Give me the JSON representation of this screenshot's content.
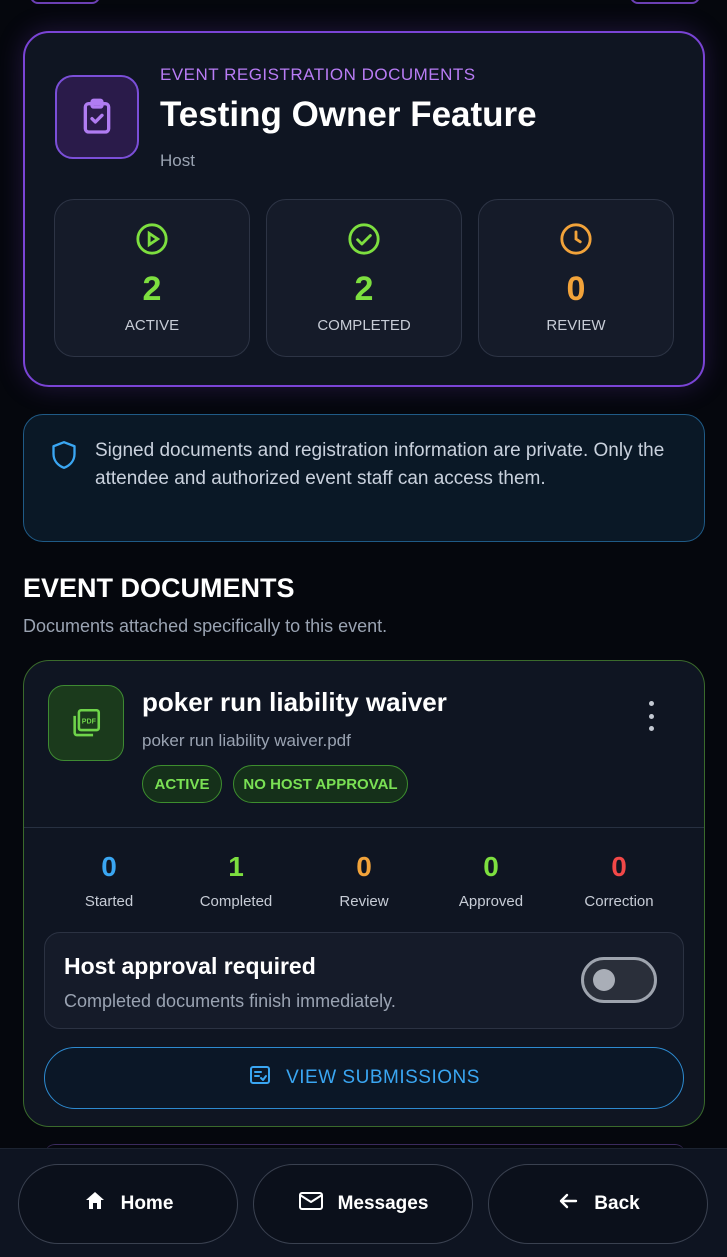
{
  "header": {
    "eyebrow": "EVENT REGISTRATION DOCUMENTS",
    "title": "Testing Owner Feature",
    "role": "Host",
    "icon": "clipboard-check-icon",
    "stats": [
      {
        "value": "2",
        "label": "ACTIVE",
        "color": "#7ddf3f",
        "icon": "play-circle-icon"
      },
      {
        "value": "2",
        "label": "COMPLETED",
        "color": "#7ddf3f",
        "icon": "check-circle-icon"
      },
      {
        "value": "0",
        "label": "REVIEW",
        "color": "#f2a33a",
        "icon": "clock-icon"
      }
    ]
  },
  "privacy": {
    "text": "Signed documents and registration information are private. Only the attendee and authorized event staff can access them."
  },
  "section": {
    "title": "EVENT DOCUMENTS",
    "subtitle": "Documents attached specifically to this event."
  },
  "document": {
    "name": "poker run liability waiver",
    "file": "poker run liability waiver.pdf",
    "badges": [
      "ACTIVE",
      "NO HOST APPROVAL"
    ],
    "metrics": [
      {
        "value": "0",
        "label": "Started",
        "color": "#3aa6f2"
      },
      {
        "value": "1",
        "label": "Completed",
        "color": "#7ddf3f"
      },
      {
        "value": "0",
        "label": "Review",
        "color": "#f2a33a"
      },
      {
        "value": "0",
        "label": "Approved",
        "color": "#7ddf3f"
      },
      {
        "value": "0",
        "label": "Correction",
        "color": "#f24848"
      }
    ],
    "approval": {
      "title": "Host approval required",
      "subtitle": "Completed documents finish immediately.",
      "enabled": false
    },
    "view_label": "VIEW SUBMISSIONS"
  },
  "nav": {
    "home": "Home",
    "messages": "Messages",
    "back": "Back"
  }
}
